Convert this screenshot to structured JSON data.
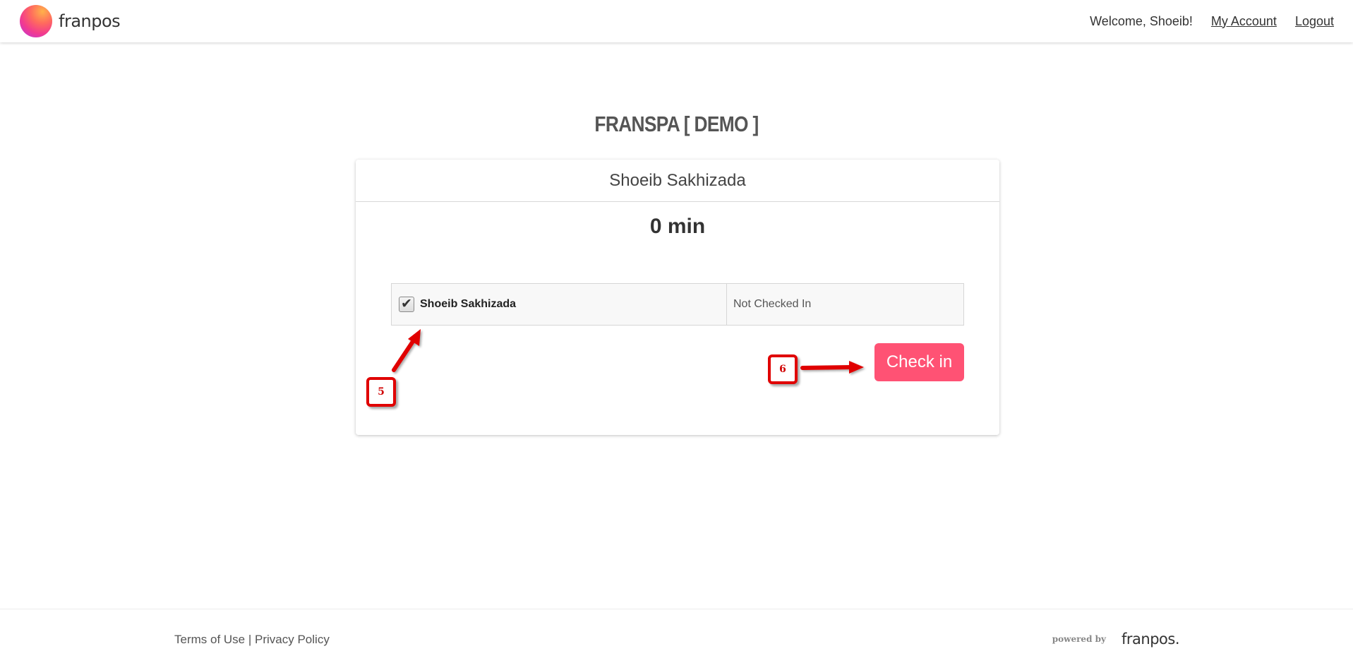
{
  "navbar": {
    "brand_name": "franpos",
    "welcome_text": "Welcome, Shoeib!",
    "my_account_label": "My Account",
    "logout_label": "Logout"
  },
  "page": {
    "title": "FRANSPA [ DEMO ]"
  },
  "card": {
    "header_name": "Shoeib Sakhizada",
    "duration": "0 min",
    "attendees": [
      {
        "name": "Shoeib Sakhizada",
        "checked": true,
        "status": "Not Checked In"
      }
    ],
    "checkin_label": "Check in"
  },
  "annotations": {
    "badge_5": "5",
    "badge_6": "6",
    "color": "#e00000"
  },
  "footer": {
    "terms_label": "Terms of Use",
    "separator": " | ",
    "privacy_label": "Privacy Policy",
    "powered_by_label": "powered by",
    "powered_logo": "franpos."
  },
  "colors": {
    "accent": "#ff5274",
    "text": "#333333"
  }
}
